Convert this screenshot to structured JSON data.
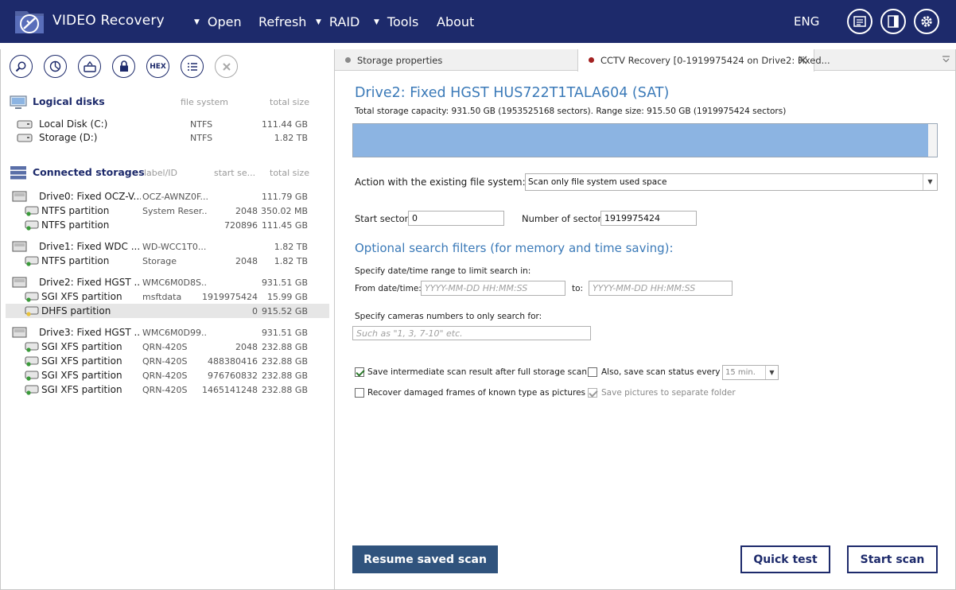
{
  "app": {
    "title": "VIDEO Recovery"
  },
  "menu": {
    "open": "Open",
    "refresh": "Refresh",
    "raid": "RAID",
    "tools": "Tools",
    "about": "About",
    "lang": "ENG"
  },
  "left": {
    "logical_header": "Logical disks",
    "logical_cols": {
      "fs": "file system",
      "size": "total size"
    },
    "logical": [
      {
        "name": "Local Disk (C:)",
        "fs": "NTFS",
        "size": "111.44 GB"
      },
      {
        "name": "Storage (D:)",
        "fs": "NTFS",
        "size": "1.82 TB"
      }
    ],
    "storages_header": "Connected storages",
    "storage_cols": {
      "label": "label/ID",
      "start": "start se...",
      "size": "total size"
    },
    "storages": [
      {
        "name": "Drive0: Fixed OCZ-V...",
        "label": "OCZ-AWNZ0F...",
        "start": "",
        "size": "111.79 GB",
        "kind": "drive"
      },
      {
        "name": "NTFS partition",
        "label": "System Reser...",
        "start": "2048",
        "size": "350.02 MB",
        "kind": "part"
      },
      {
        "name": "NTFS partition",
        "label": "",
        "start": "720896",
        "size": "111.45 GB",
        "kind": "part"
      },
      {
        "name": "Drive1: Fixed WDC ...",
        "label": "WD-WCC1T0...",
        "start": "",
        "size": "1.82 TB",
        "kind": "drive"
      },
      {
        "name": "NTFS partition",
        "label": "Storage",
        "start": "2048",
        "size": "1.82 TB",
        "kind": "part"
      },
      {
        "name": "Drive2: Fixed HGST ...",
        "label": "WMC6M0D8S...",
        "start": "",
        "size": "931.51 GB",
        "kind": "drive"
      },
      {
        "name": "SGI XFS partition",
        "label": "msftdata",
        "start": "1919975424",
        "size": "15.99 GB",
        "kind": "part"
      },
      {
        "name": "DHFS partition",
        "label": "",
        "start": "0",
        "size": "915.52 GB",
        "kind": "part",
        "selected": true
      },
      {
        "name": "Drive3: Fixed HGST ...",
        "label": "WMC6M0D99...",
        "start": "",
        "size": "931.51 GB",
        "kind": "drive"
      },
      {
        "name": "SGI XFS partition",
        "label": "QRN-420S",
        "start": "2048",
        "size": "232.88 GB",
        "kind": "part"
      },
      {
        "name": "SGI XFS partition",
        "label": "QRN-420S",
        "start": "488380416",
        "size": "232.88 GB",
        "kind": "part"
      },
      {
        "name": "SGI XFS partition",
        "label": "QRN-420S",
        "start": "976760832",
        "size": "232.88 GB",
        "kind": "part"
      },
      {
        "name": "SGI XFS partition",
        "label": "QRN-420S",
        "start": "1465141248",
        "size": "232.88 GB",
        "kind": "part"
      }
    ],
    "toolbar": {
      "hex": "HEX"
    }
  },
  "tabs": [
    {
      "label": "Storage properties",
      "active": false
    },
    {
      "label": "CCTV Recovery [0-1919975424 on Drive2: Fixed...",
      "active": true
    }
  ],
  "main": {
    "title": "Drive2: Fixed HGST HUS722T1TALA604 (SAT)",
    "capacity": "Total storage capacity: 931.50 GB (1953525168 sectors). Range size: 915.50 GB (1919975424 sectors)",
    "range_fill": 0.985,
    "action_label": "Action with the existing file system:",
    "action_value": "Scan only file system used space",
    "start_label": "Start sector:",
    "start_value": "0",
    "num_label": "Number of sectors:",
    "num_value": "1919975424",
    "filters_title": "Optional search filters (for memory and time saving):",
    "date_hint": "Specify date/time range to limit search in:",
    "from_label": "From date/time:",
    "date_placeholder": "YYYY-MM-DD HH:MM:SS",
    "to_label": "to:",
    "cam_hint": "Specify cameras numbers to only search for:",
    "cam_placeholder": "Such as \"1, 3, 7-10\" etc.",
    "opt_save_intermediate": "Save intermediate scan result after full storage scan",
    "opt_save_status": "Also, save scan status every",
    "interval": "15 min.",
    "opt_recover_frames": "Recover damaged frames of known type as pictures",
    "opt_separate_folder": "Save pictures to separate folder",
    "btn_resume": "Resume saved scan",
    "btn_quick": "Quick test",
    "btn_start": "Start scan"
  },
  "colors": {
    "navy": "#1d2a6b",
    "accent": "#3b7ab8",
    "bar": "#8cb4e2"
  }
}
